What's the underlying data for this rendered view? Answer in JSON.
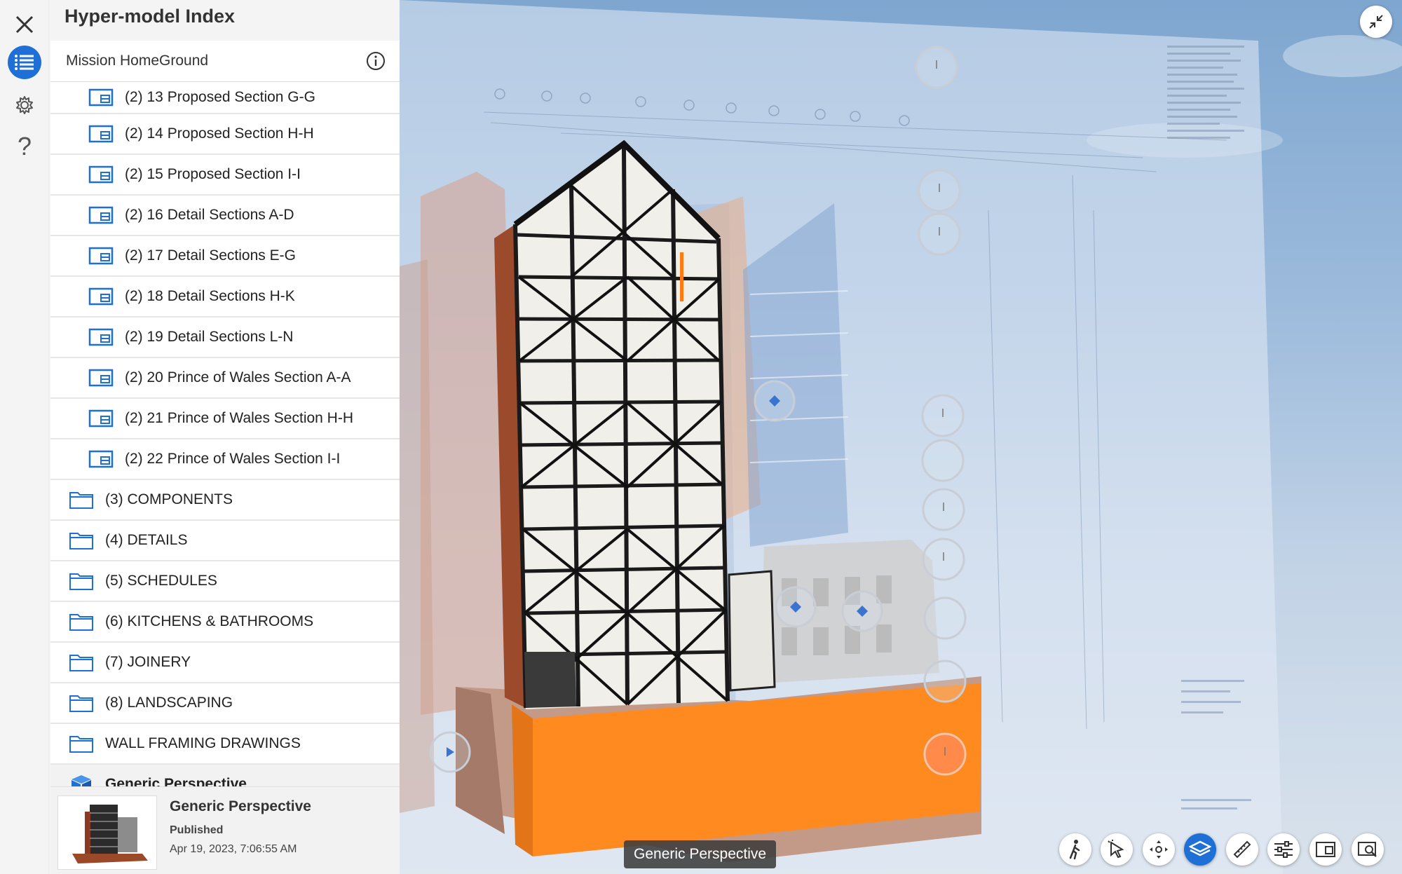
{
  "panel": {
    "title": "Hyper-model Index",
    "project": "Mission HomeGround",
    "sheets": [
      "(2) 13 Proposed Section G-G",
      "(2) 14 Proposed Section H-H",
      "(2) 15 Proposed Section I-I",
      "(2) 16 Detail Sections A-D",
      "(2) 17 Detail Sections E-G",
      "(2) 18 Detail Sections H-K",
      "(2) 19 Detail Sections L-N",
      "(2) 20 Prince of Wales Section A-A",
      "(2) 21 Prince of Wales Section H-H",
      "(2) 22 Prince of Wales Section I-I"
    ],
    "folders": [
      "(3) COMPONENTS",
      "(4) DETAILS",
      "(5) SCHEDULES",
      "(6) KITCHENS & BATHROOMS",
      "(7) JOINERY",
      "(8) LANDSCAPING",
      "WALL FRAMING DRAWINGS"
    ],
    "selected_view": "Generic Perspective",
    "detail": {
      "title": "Generic Perspective",
      "status": "Published",
      "date": "Apr 19, 2023, 7:06:55 AM"
    }
  },
  "rail": {
    "icons": [
      "close-icon",
      "list-icon",
      "gear-icon",
      "help-icon"
    ],
    "help_glyph": "?"
  },
  "viewport": {
    "view_label": "Generic Perspective",
    "toolbar": [
      "walk-icon",
      "select-icon",
      "navigate-icon",
      "sheets-icon",
      "measure-icon",
      "settings-sliders-icon",
      "sheet-view-icon",
      "zoom-view-icon"
    ],
    "active_tool": "sheets-icon",
    "accent": "#1e6fd6",
    "building_orange": "#ff8a1f"
  }
}
